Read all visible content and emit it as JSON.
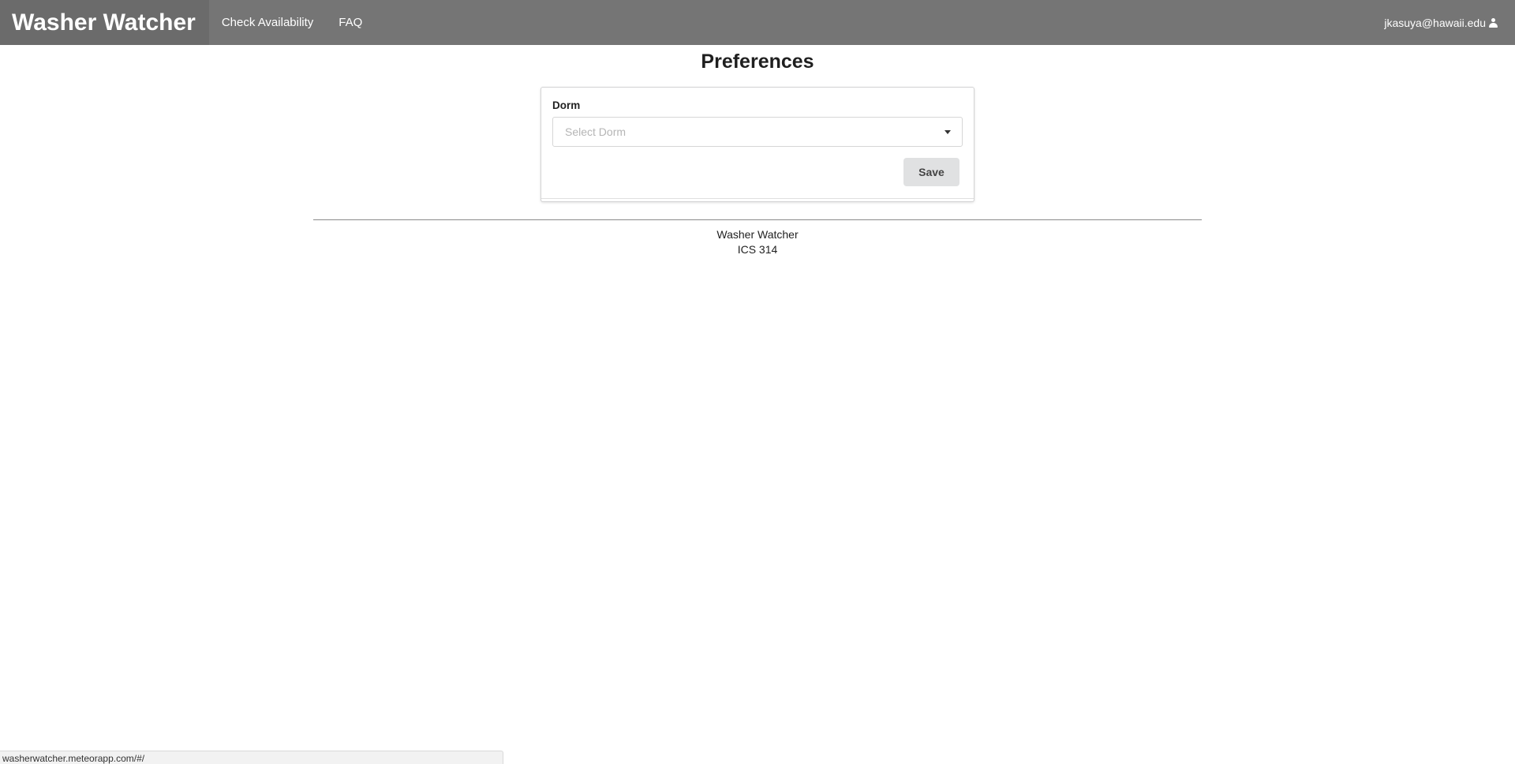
{
  "navbar": {
    "brand": "Washer Watcher",
    "items": [
      {
        "label": "Check Availability"
      },
      {
        "label": "FAQ"
      }
    ],
    "user": {
      "email": "jkasuya@hawaii.edu",
      "icon": "user-icon"
    }
  },
  "page": {
    "title": "Preferences"
  },
  "form": {
    "dorm_label": "Dorm",
    "dorm_placeholder": "Select Dorm",
    "save_label": "Save"
  },
  "footer": {
    "line1": "Washer Watcher",
    "line2": "ICS 314"
  },
  "status_bar": {
    "url": "washerwatcher.meteorapp.com/#/"
  },
  "colors": {
    "navbar_bg": "#757575",
    "brand_bg": "#6b6b6b",
    "button_bg": "#e0e1e2"
  }
}
